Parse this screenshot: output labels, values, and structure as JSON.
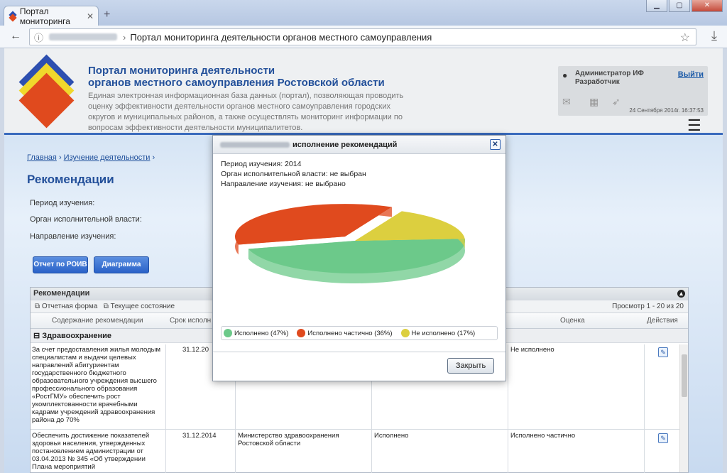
{
  "browser": {
    "tab_title": "Портал мониторинга",
    "new_tab": "+",
    "address_title": "Портал мониторинга деятельности органов местного самоуправления"
  },
  "header": {
    "title_line1": "Портал мониторинга деятельности",
    "title_line2": "органов местного самоуправления Ростовской области",
    "description": "Единая электронная информационная база данных (портал), позволяющая проводить оценку эффективности деятельности органов местного самоуправления городских округов и муниципальных районов, а также осуществлять мониторинг информации по вопросам эффективности деятельности муниципалитетов.",
    "user_line1": "Администратор ИФ",
    "user_line2": "Разработчик",
    "logout": "Выйти",
    "datetime": "24 Сентября 2014г. 16:37:53"
  },
  "breadcrumb": {
    "home": "Главная",
    "sep": "›",
    "study": "Изучение деятельности"
  },
  "page_title": "Рекомендации",
  "filters": {
    "period": "Период изучения:",
    "organ": "Орган исполнительной власти:",
    "direction": "Направление изучения:"
  },
  "buttons": {
    "report": "Отчет по РОИВ",
    "chart": "Диаграмма"
  },
  "grid": {
    "title": "Рекомендации",
    "tool1": "Отчетная форма",
    "tool2": "Текущее состояние",
    "paging": "Просмотр 1 - 20 из 20",
    "col_content": "Содержание рекомендации",
    "col_term": "Срок исполн",
    "col_rating": "Оценка",
    "col_actions": "Действия",
    "group": "Здравоохранение",
    "rows": [
      {
        "content": "За счет предоставления жилья молодым специалистам и выдачи целевых направлений абитуриентам государственного бюджетного образовательного учреждения высшего профессионального образования «РостГМУ» обеспечить рост укомплектованности врачебными кадрами учреждений здравоохранения района до 70%",
        "term": "31.12.20",
        "organ": "",
        "status": "",
        "rating": "Не исполнено"
      },
      {
        "content": "Обеспечить достижение показателей здоровья населения, утвержденных постановлением администрации от 03.04.2013 № 345 «Об утверждении Плана мероприятий",
        "term": "31.12.2014",
        "organ": "Министерство здравоохранения Ростовской области",
        "status": "Исполнено",
        "rating": "Исполнено частично"
      }
    ]
  },
  "modal": {
    "title": "исполнение рекомендаций",
    "period": "Период изучения: 2014",
    "organ": "Орган исполнительной власти: не выбран",
    "direction": "Направление изучения: не выбрано",
    "close_button": "Закрыть"
  },
  "chart_data": {
    "type": "pie",
    "title": "",
    "categories": [
      "Исполнено (47%)",
      "Исполнено частично (36%)",
      "Не исполнено (17%)"
    ],
    "values": [
      47,
      36,
      17
    ],
    "colors": [
      "#6cc98a",
      "#e04a1e",
      "#dccf3f"
    ]
  }
}
